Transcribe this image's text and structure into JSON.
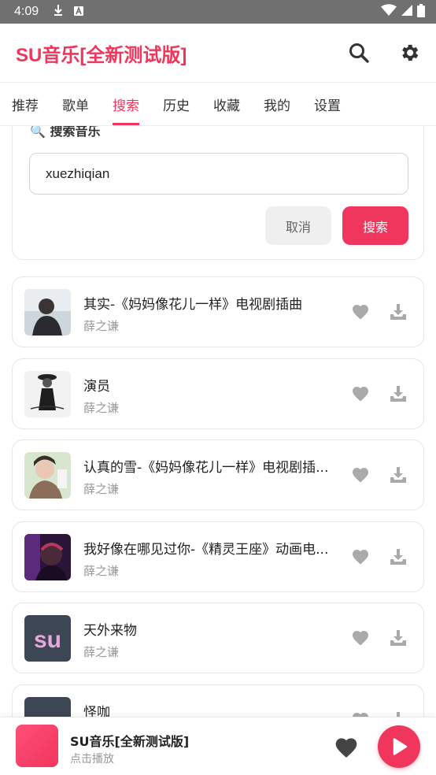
{
  "status_bar": {
    "time": "4:09"
  },
  "app": {
    "title": "SU音乐[全新测试版]",
    "accent": "#f0365d"
  },
  "tabs": [
    {
      "label": "推荐",
      "active": false
    },
    {
      "label": "歌单",
      "active": false
    },
    {
      "label": "搜索",
      "active": true
    },
    {
      "label": "历史",
      "active": false
    },
    {
      "label": "收藏",
      "active": false
    },
    {
      "label": "我的",
      "active": false
    },
    {
      "label": "设置",
      "active": false
    }
  ],
  "search": {
    "heading": "🔍 搜索音乐",
    "input_value": "xuezhiqian",
    "cancel_label": "取消",
    "search_label": "搜索"
  },
  "songs": [
    {
      "title": "其实-《妈妈像花儿一样》电视剧插曲",
      "artist": "薛之谦",
      "cover": "person-photo"
    },
    {
      "title": "演员",
      "artist": "薛之谦",
      "cover": "person-photo"
    },
    {
      "title": "认真的雪-《妈妈像花儿一样》电视剧插...",
      "artist": "薛之谦",
      "cover": "person-photo"
    },
    {
      "title": "我好像在哪见过你-《精灵王座》动画电...",
      "artist": "薛之谦",
      "cover": "person-photo"
    },
    {
      "title": "天外来物",
      "artist": "薛之谦",
      "cover": "su-logo"
    },
    {
      "title": "怪咖",
      "artist": "",
      "cover": "su-logo"
    }
  ],
  "player": {
    "title": "SU音乐[全新测试版]",
    "subtitle": "点击播放"
  }
}
